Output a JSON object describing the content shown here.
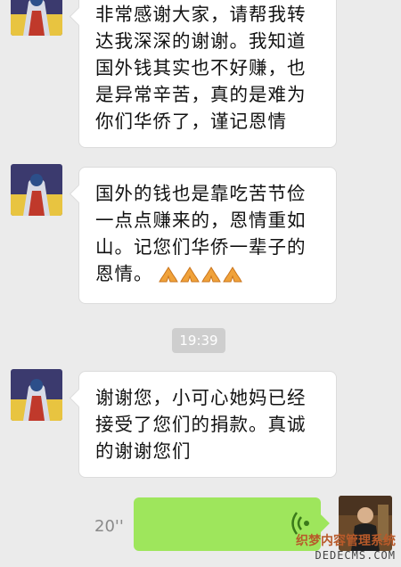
{
  "messages": [
    {
      "lines": [
        "非常感谢大家，请帮我转",
        "达我深深的谢谢。我知道",
        "国外钱其实也不好赚，也",
        "是异常辛苦，真的是难为",
        "你们华侨了，谨记恩情"
      ]
    },
    {
      "lines": [
        "国外的钱也是靠吃苦节俭",
        "一点点赚来的，恩情重如",
        "山。记您们华侨一辈子的",
        "恩情。"
      ],
      "emoji": "praying-hands-icon"
    },
    {
      "lines": [
        "谢谢您，小可心她妈已经",
        "接受了您们的捐款。真诚",
        "的谢谢您们"
      ]
    }
  ],
  "timestamp": "19:39",
  "voice_message": {
    "duration": "20''"
  },
  "watermark": {
    "line1": "织梦内容管理系统",
    "line2": "DEDECMS.COM"
  },
  "colors": {
    "background": "#ebebeb",
    "voice_bubble": "#9ee65c",
    "bubble": "#ffffff"
  }
}
